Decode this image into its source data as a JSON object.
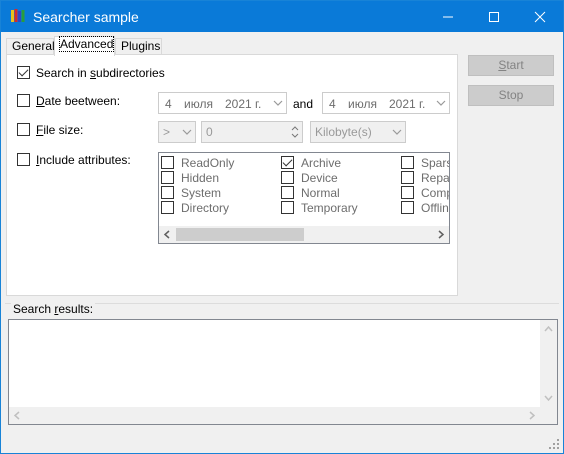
{
  "window": {
    "title": "Searcher sample"
  },
  "tabs": [
    {
      "label": "General",
      "active": false
    },
    {
      "label": "Advanced",
      "active": true
    },
    {
      "label": "Plugins",
      "active": false
    }
  ],
  "advanced": {
    "search_subdirs": {
      "label_pre": "Search in ",
      "label_u": "s",
      "label_post": "ubdirectories",
      "checked": true
    },
    "date_between": {
      "label_u": "D",
      "label_post": "ate beetween:",
      "checked": false,
      "from": {
        "day": "4",
        "month": "июля",
        "year": "2021 г."
      },
      "and_label": "and",
      "to": {
        "day": "4",
        "month": "июля",
        "year": "2021 г."
      }
    },
    "file_size": {
      "label_u": "F",
      "label_post": "ile size:",
      "checked": false,
      "operator": ">",
      "value": "0",
      "unit": "Kilobyte(s)"
    },
    "include_attributes": {
      "label_u": "I",
      "label_post": "nclude attributes:",
      "checked": false,
      "items": [
        {
          "label": "ReadOnly",
          "checked": false
        },
        {
          "label": "Hidden",
          "checked": false
        },
        {
          "label": "System",
          "checked": false
        },
        {
          "label": "Directory",
          "checked": false
        },
        {
          "label": "Archive",
          "checked": true
        },
        {
          "label": "Device",
          "checked": false
        },
        {
          "label": "Normal",
          "checked": false
        },
        {
          "label": "Temporary",
          "checked": false
        },
        {
          "label": "Sparse",
          "checked": false
        },
        {
          "label": "Repar",
          "checked": false
        },
        {
          "label": "Compr",
          "checked": false
        },
        {
          "label": "Offline",
          "checked": false
        }
      ]
    }
  },
  "buttons": {
    "start": "Start",
    "start_u": "S",
    "start_post": "tart",
    "stop_u": "Stop"
  },
  "results": {
    "label_pre": "Search ",
    "label_u": "r",
    "label_post": "esults:"
  }
}
